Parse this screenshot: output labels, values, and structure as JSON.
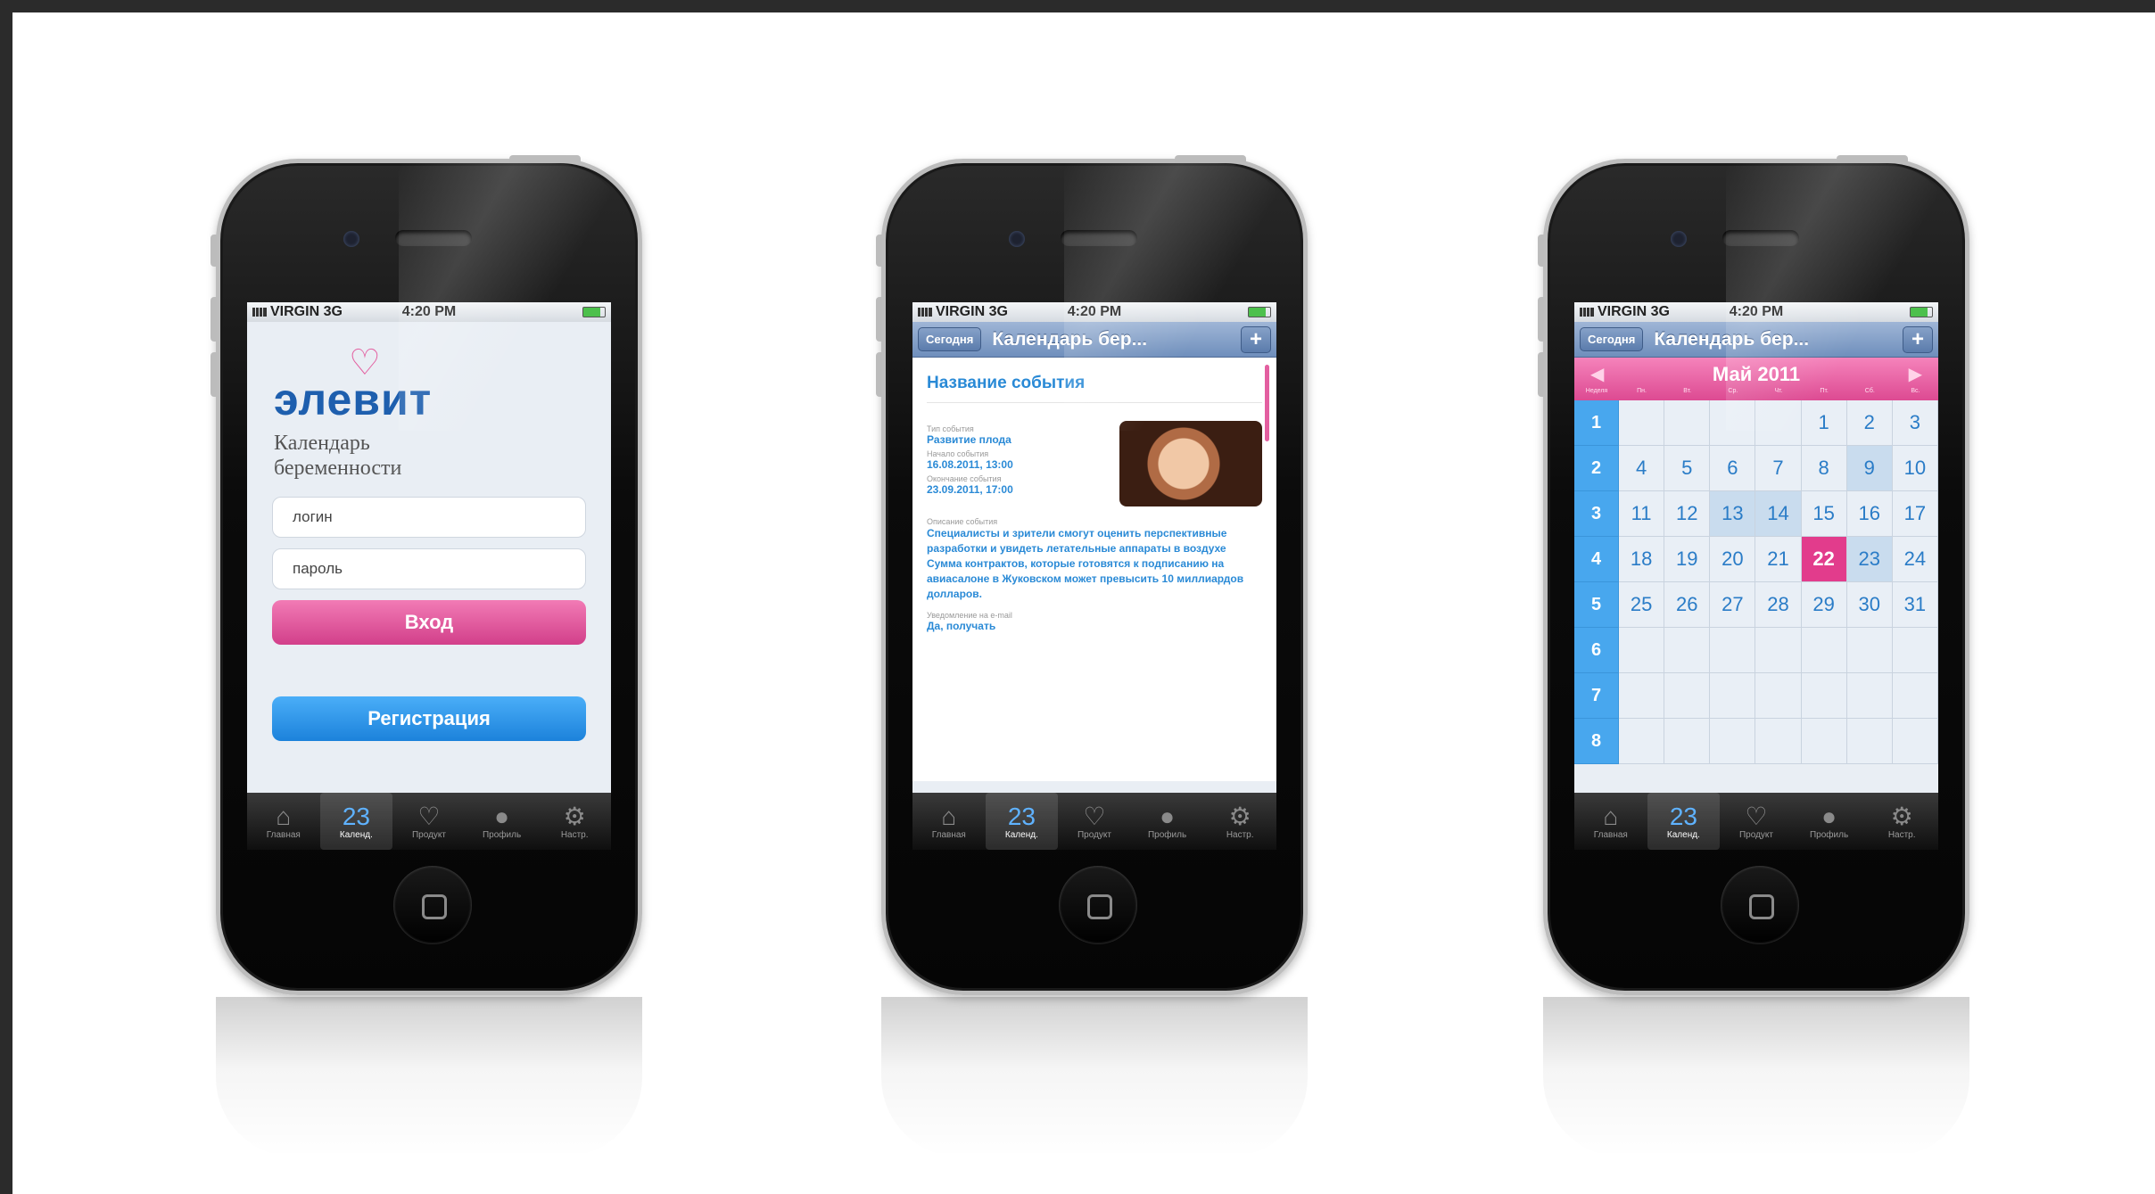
{
  "status": {
    "carrier": "VIRGIN 3G",
    "time": "4:20 PM"
  },
  "tabs": [
    {
      "label": "Главная",
      "icon": "home-icon",
      "glyph": "⌂"
    },
    {
      "label": "Календ.",
      "icon": "calendar-icon",
      "glyph": "23"
    },
    {
      "label": "Продукт",
      "icon": "product-icon",
      "glyph": "♡"
    },
    {
      "label": "Профиль",
      "icon": "profile-icon",
      "glyph": "●"
    },
    {
      "label": "Настр.",
      "icon": "gear-icon",
      "glyph": "⚙"
    }
  ],
  "active_tab": 1,
  "login": {
    "logo": "элевит",
    "logo_mark": "♡",
    "subtitle_line1": "Календарь",
    "subtitle_line2": "беременности",
    "login_placeholder": "логин",
    "password_placeholder": "пароль",
    "submit_label": "Вход",
    "register_label": "Регистрация"
  },
  "navbar": {
    "today_label": "Сегодня",
    "title": "Календарь бер...",
    "add_label": "+"
  },
  "event": {
    "title": "Название события",
    "type_label": "Тип события",
    "type_value": "Развитие плода",
    "start_label": "Начало события",
    "start_value": "16.08.2011, 13:00",
    "end_label": "Окончание события",
    "end_value": "23.09.2011, 17:00",
    "desc_label": "Описание события",
    "desc_value": "Специалисты и зрители смогут оценить перспективные разработки и увидеть летательные аппараты в воздухе Сумма контрактов, которые готовятся к подписанию на авиасалоне в Жуковском может превысить 10 миллиардов долларов.",
    "notify_label": "Уведомление на e-mail",
    "notify_value": "Да, получать"
  },
  "calendar": {
    "month": "Май 2011",
    "weekday_labels": [
      "Неделя",
      "Пн.",
      "Вт.",
      "Ср.",
      "Чт.",
      "Пт.",
      "Сб.",
      "Вс."
    ],
    "rows": [
      {
        "week": "1",
        "days": [
          "",
          "",
          "",
          "",
          "1",
          "2",
          "3"
        ]
      },
      {
        "week": "2",
        "days": [
          "4",
          "5",
          "6",
          "7",
          "8",
          "9",
          "10"
        ]
      },
      {
        "week": "3",
        "days": [
          "11",
          "12",
          "13",
          "14",
          "15",
          "16",
          "17"
        ]
      },
      {
        "week": "4",
        "days": [
          "18",
          "19",
          "20",
          "21",
          "22",
          "23",
          "24"
        ]
      },
      {
        "week": "5",
        "days": [
          "25",
          "26",
          "27",
          "28",
          "29",
          "30",
          "31"
        ]
      },
      {
        "week": "6",
        "days": [
          "",
          "",
          "",
          "",
          "",
          "",
          ""
        ]
      },
      {
        "week": "7",
        "days": [
          "",
          "",
          "",
          "",
          "",
          "",
          ""
        ]
      },
      {
        "week": "8",
        "days": [
          "",
          "",
          "",
          "",
          "",
          "",
          ""
        ]
      }
    ],
    "highlighted": [
      "9",
      "13",
      "14",
      "23"
    ],
    "today": "22"
  },
  "colors": {
    "brand_blue": "#1e5fae",
    "accent_pink": "#e23c8c",
    "link_blue": "#2a8ad6"
  }
}
